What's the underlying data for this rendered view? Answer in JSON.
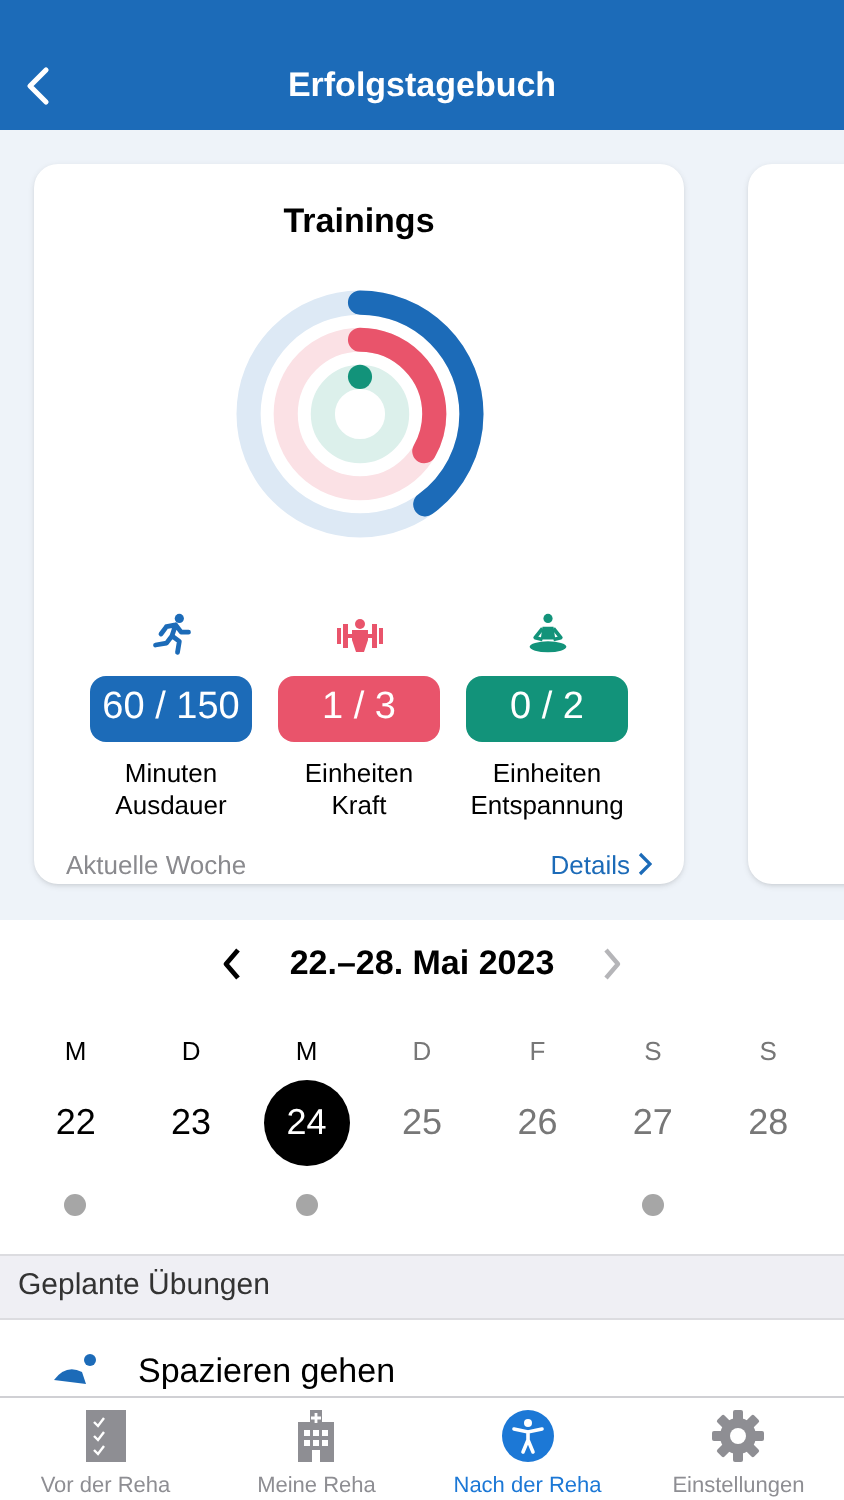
{
  "header": {
    "title": "Erfolgstagebuch"
  },
  "card": {
    "title": "Trainings",
    "rings": [
      {
        "kind": "endurance",
        "color": "#1c6bb8",
        "level": 0.4
      },
      {
        "kind": "strength",
        "color": "#e9546b",
        "level": 0.333
      },
      {
        "kind": "relax",
        "color": "#12937a",
        "level": 0
      }
    ],
    "metrics": [
      {
        "kind": "endurance",
        "color": "#1c6bb8",
        "value": "60 / 150",
        "label": "Minuten\nAusdauer"
      },
      {
        "kind": "strength",
        "color": "#e9546b",
        "value": "1 / 3",
        "label": "Einheiten\nKraft"
      },
      {
        "kind": "relax",
        "color": "#12937a",
        "value": "0 / 2",
        "label": "Einheiten\nEntspannung"
      }
    ],
    "footer": "Aktuelle Woche",
    "details_link": "Details"
  },
  "week": {
    "range": "22.–28. Mai 2023",
    "next_disabled": true,
    "days": [
      {
        "weekday": "M",
        "date": "22",
        "selected": false,
        "past": true,
        "has_entry": true
      },
      {
        "weekday": "D",
        "date": "23",
        "selected": false,
        "past": true,
        "has_entry": false
      },
      {
        "weekday": "M",
        "date": "24",
        "selected": true,
        "past": true,
        "has_entry": true
      },
      {
        "weekday": "D",
        "date": "25",
        "selected": false,
        "past": false,
        "has_entry": false
      },
      {
        "weekday": "F",
        "date": "26",
        "selected": false,
        "past": false,
        "has_entry": false
      },
      {
        "weekday": "S",
        "date": "27",
        "selected": false,
        "past": false,
        "has_entry": true
      },
      {
        "weekday": "S",
        "date": "28",
        "selected": false,
        "past": false,
        "has_entry": false
      }
    ]
  },
  "planned": {
    "heading": "Geplante Übungen",
    "items": [
      {
        "title": "Spazieren gehen"
      }
    ]
  },
  "tab_bar": [
    {
      "kind": "checklist",
      "label": "Vor der Reha",
      "selected": false
    },
    {
      "kind": "hospital",
      "label": "Meine Reha",
      "selected": false
    },
    {
      "kind": "person",
      "label": "Nach der Reha",
      "selected": true
    },
    {
      "kind": "gear",
      "label": "Einstellungen",
      "selected": false
    }
  ]
}
